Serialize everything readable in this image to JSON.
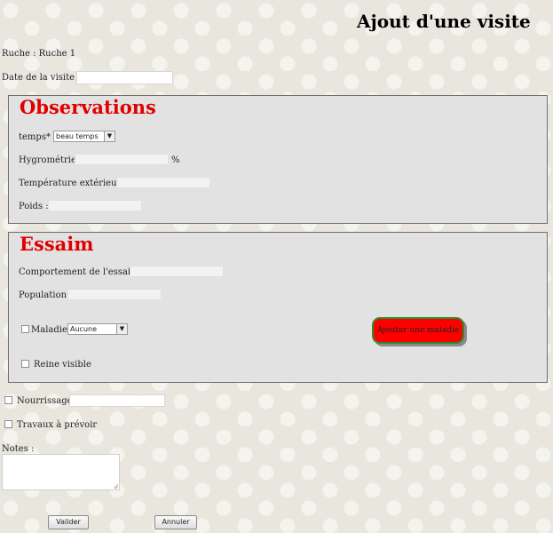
{
  "page": {
    "title": "Ajout d'une visite"
  },
  "ruche": {
    "label": "Ruche : Ruche 1"
  },
  "visit_date": {
    "label": "Date de la visite *:",
    "value": ""
  },
  "observations": {
    "legend": "Observations",
    "weather": {
      "label": "temps* :",
      "selected": "beau temps"
    },
    "humidity": {
      "label": "Hygrométrie :",
      "value": "",
      "unit": "%"
    },
    "temperature": {
      "label": "Température extérieure :",
      "value": ""
    },
    "weight": {
      "label": "Poids :",
      "value": ""
    }
  },
  "swarm": {
    "legend": "Essaim",
    "behavior": {
      "label": "Comportement de l'essaim :",
      "value": ""
    },
    "population": {
      "label": "Population :",
      "value": ""
    },
    "disease": {
      "label": "Maladie",
      "checked": false,
      "selected": "Aucune"
    },
    "add_disease_button": "Ajouter une maladie",
    "queen_visible": {
      "label": "Reine visible",
      "checked": false
    }
  },
  "feeding": {
    "label": "Nourrissage:",
    "checked": false,
    "value": ""
  },
  "works": {
    "label": "Travaux à prévoir",
    "checked": false
  },
  "notes": {
    "label": "Notes  :",
    "value": ""
  },
  "buttons": {
    "submit": "Valider",
    "cancel": "Annuler"
  },
  "colors": {
    "legend": "#e00000",
    "add_button_bg": "#ff0000",
    "add_button_border": "#2f8a2f"
  }
}
